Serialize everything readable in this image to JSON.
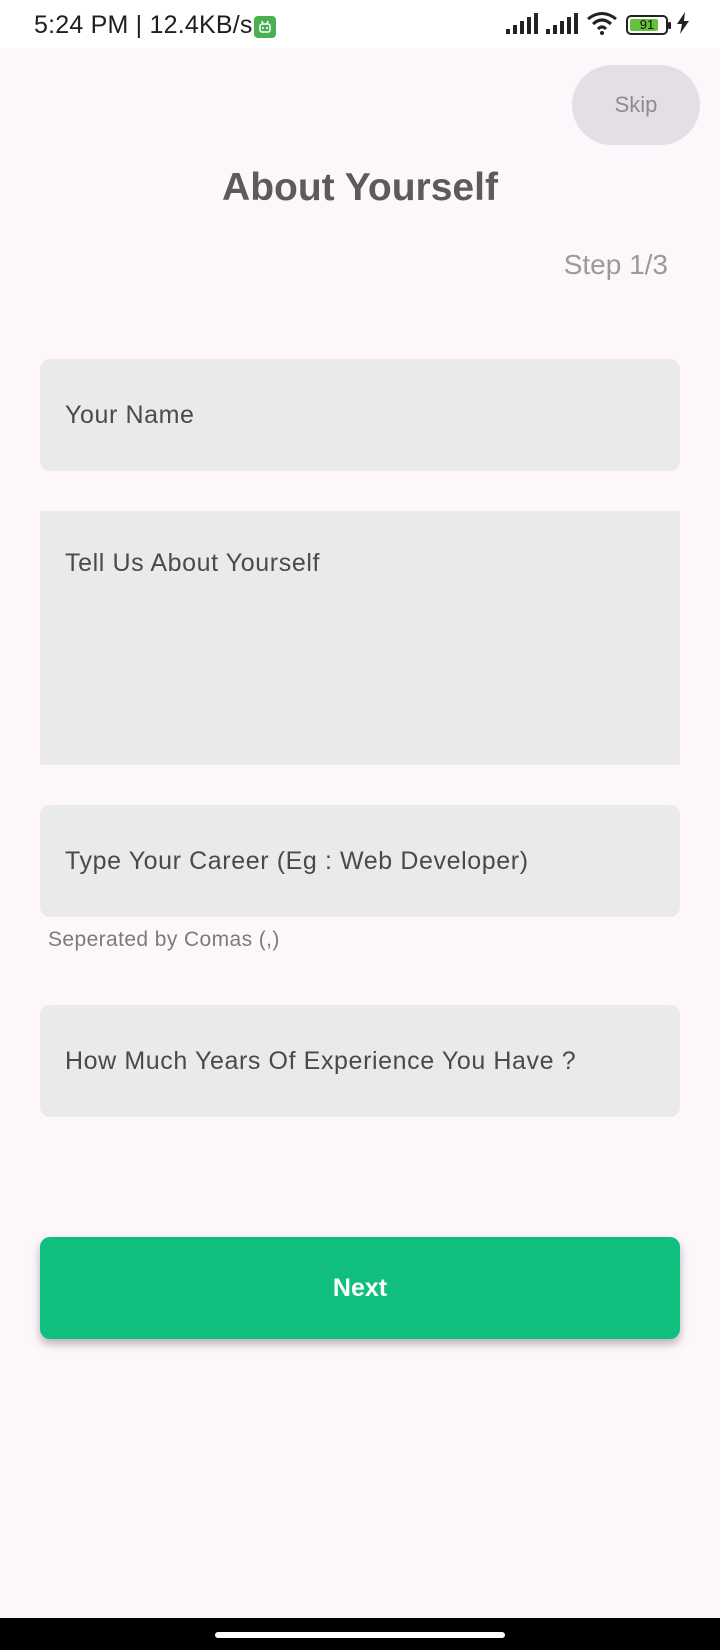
{
  "status_bar": {
    "time_speed": "5:24 PM | 12.4KB/s",
    "battery_level": "91",
    "icons": [
      "app-notification-icon",
      "signal-icon",
      "signal-icon",
      "wifi-icon",
      "battery-icon",
      "charging-icon"
    ]
  },
  "header": {
    "skip_label": "Skip",
    "title": "About Yourself",
    "step": "Step 1/3"
  },
  "form": {
    "name_placeholder": "Your Name",
    "about_placeholder": "Tell Us About Yourself",
    "career_placeholder": "Type Your Career (Eg : Web Developer)",
    "career_helper": "Seperated by Comas (,)",
    "experience_placeholder": "How Much Years Of Experience You Have ?"
  },
  "actions": {
    "next_label": "Next"
  },
  "colors": {
    "background": "#fdf7fb",
    "field": "#eaeaea",
    "accent": "#10bf7e",
    "skip_bg": "#e3dfe4"
  }
}
